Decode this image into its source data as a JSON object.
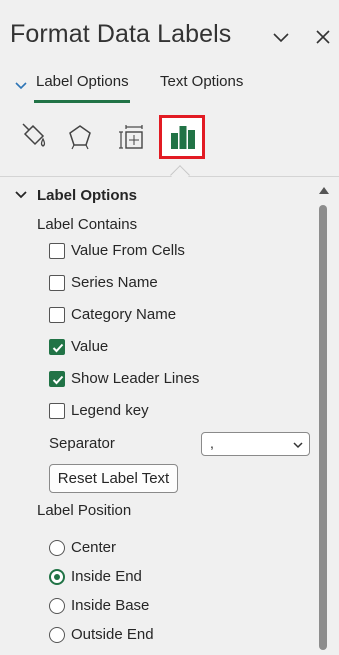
{
  "header": {
    "title": "Format Data Labels",
    "collapse_icon": "chevron-down-icon",
    "close_icon": "close-icon"
  },
  "tabs": [
    {
      "label": "Label Options",
      "active": true
    },
    {
      "label": "Text Options",
      "active": false
    }
  ],
  "icon_tabs": [
    {
      "name": "fill-line-icon",
      "tooltip": "Fill & Line"
    },
    {
      "name": "effects-icon",
      "tooltip": "Effects"
    },
    {
      "name": "size-properties-icon",
      "tooltip": "Size & Properties"
    },
    {
      "name": "label-options-chart-icon",
      "tooltip": "Label Options",
      "active": true
    }
  ],
  "section": {
    "title": "Label Options",
    "label_contains": {
      "heading": "Label Contains",
      "items": [
        {
          "label": "Value From Cells",
          "checked": false
        },
        {
          "label": "Series Name",
          "checked": false
        },
        {
          "label": "Category Name",
          "checked": false
        },
        {
          "label": "Value",
          "checked": true
        },
        {
          "label": "Show Leader Lines",
          "checked": true
        },
        {
          "label": "Legend key",
          "checked": false
        }
      ]
    },
    "separator": {
      "label": "Separator",
      "value": ","
    },
    "reset_button": "Reset Label Text",
    "label_position": {
      "heading": "Label Position",
      "options": [
        {
          "label": "Center",
          "selected": false
        },
        {
          "label": "Inside End",
          "selected": true
        },
        {
          "label": "Inside Base",
          "selected": false
        },
        {
          "label": "Outside End",
          "selected": false
        }
      ]
    }
  },
  "colors": {
    "accent": "#217346",
    "highlight_box": "#e21b23",
    "pane_bg": "#f0f0f0"
  }
}
